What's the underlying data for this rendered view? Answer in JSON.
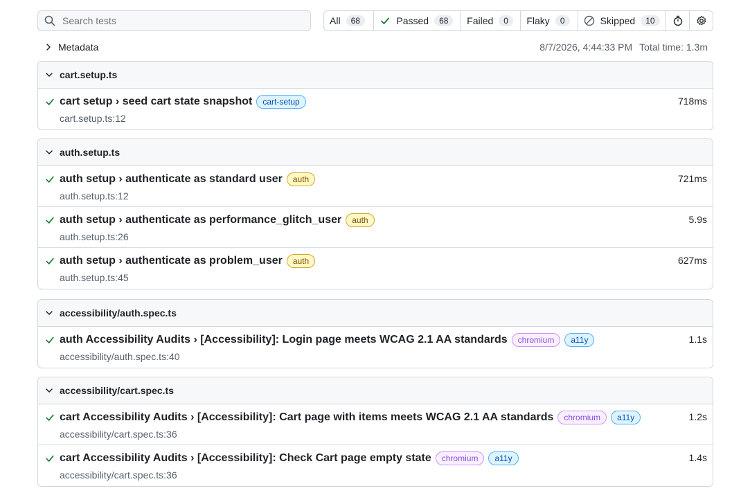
{
  "search": {
    "placeholder": "Search tests",
    "value": ""
  },
  "filters": [
    {
      "label": "All",
      "count": "68",
      "icon": "none"
    },
    {
      "label": "Passed",
      "count": "68",
      "icon": "check-icon"
    },
    {
      "label": "Failed",
      "count": "0",
      "icon": "none"
    },
    {
      "label": "Flaky",
      "count": "0",
      "icon": "none"
    },
    {
      "label": "Skipped",
      "count": "10",
      "icon": "skip-icon"
    }
  ],
  "meta": {
    "label": "Metadata",
    "datetime": "8/7/2026, 4:44:33 PM",
    "total": "Total time: 1.3m"
  },
  "colors": {
    "pass": "#1a7f37",
    "border": "#d0d7de"
  },
  "files": [
    {
      "name": "cart.setup.ts",
      "tests": [
        {
          "title": "cart setup › seed cart state snapshot",
          "tags": [
            {
              "text": "cart-setup",
              "color": "blue"
            }
          ],
          "location": "cart.setup.ts:12",
          "duration": "718ms"
        }
      ]
    },
    {
      "name": "auth.setup.ts",
      "tests": [
        {
          "title": "auth setup › authenticate as standard user",
          "tags": [
            {
              "text": "auth",
              "color": "yellow"
            }
          ],
          "location": "auth.setup.ts:12",
          "duration": "721ms"
        },
        {
          "title": "auth setup › authenticate as performance_glitch_user",
          "tags": [
            {
              "text": "auth",
              "color": "yellow"
            }
          ],
          "location": "auth.setup.ts:26",
          "duration": "5.9s"
        },
        {
          "title": "auth setup › authenticate as problem_user",
          "tags": [
            {
              "text": "auth",
              "color": "yellow"
            }
          ],
          "location": "auth.setup.ts:45",
          "duration": "627ms"
        }
      ]
    },
    {
      "name": "accessibility/auth.spec.ts",
      "tests": [
        {
          "title": "auth Accessibility Audits › [Accessibility]: Login page meets WCAG 2.1 AA standards",
          "tags": [
            {
              "text": "chromium",
              "color": "purple"
            },
            {
              "text": "a11y",
              "color": "blue"
            }
          ],
          "location": "accessibility/auth.spec.ts:40",
          "duration": "1.1s"
        }
      ]
    },
    {
      "name": "accessibility/cart.spec.ts",
      "tests": [
        {
          "title": "cart Accessibility Audits › [Accessibility]: Cart page with items meets WCAG 2.1 AA standards",
          "tags": [
            {
              "text": "chromium",
              "color": "purple"
            },
            {
              "text": "a11y",
              "color": "blue"
            }
          ],
          "location": "accessibility/cart.spec.ts:36",
          "duration": "1.2s"
        },
        {
          "title": "cart Accessibility Audits › [Accessibility]: Check Cart page empty state",
          "tags": [
            {
              "text": "chromium",
              "color": "purple"
            },
            {
              "text": "a11y",
              "color": "blue"
            }
          ],
          "location": "accessibility/cart.spec.ts:36",
          "duration": "1.4s"
        }
      ]
    }
  ]
}
